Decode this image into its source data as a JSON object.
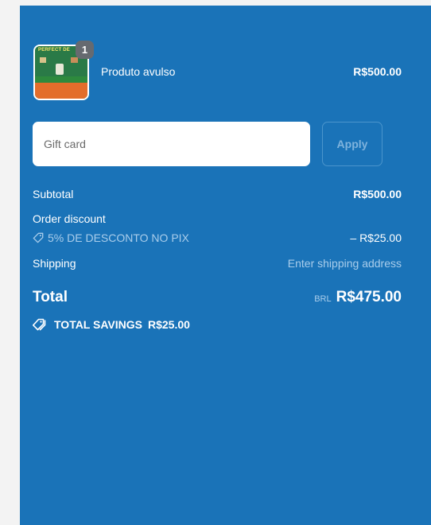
{
  "cart": {
    "item": {
      "name": "Produto avulso",
      "price": "R$500.00",
      "quantity": "1",
      "image_text": "PERFECT DE"
    }
  },
  "gift_card": {
    "placeholder": "Gift card",
    "apply_label": "Apply"
  },
  "summary": {
    "subtotal_label": "Subtotal",
    "subtotal_value": "R$500.00",
    "discount_label": "Order discount",
    "discount_code": "5% DE DESCONTO NO PIX",
    "discount_value": "– R$25.00",
    "shipping_label": "Shipping",
    "shipping_value": "Enter shipping address",
    "total_label": "Total",
    "currency": "BRL",
    "total_value": "R$475.00",
    "savings_label": "TOTAL SAVINGS",
    "savings_value": "R$25.00"
  },
  "colors": {
    "panel": "#1a73b8",
    "muted_text": "#a9cdeb",
    "badge": "#666a70"
  },
  "icons": {
    "discount": "tag-icon",
    "savings": "tags-icon"
  }
}
